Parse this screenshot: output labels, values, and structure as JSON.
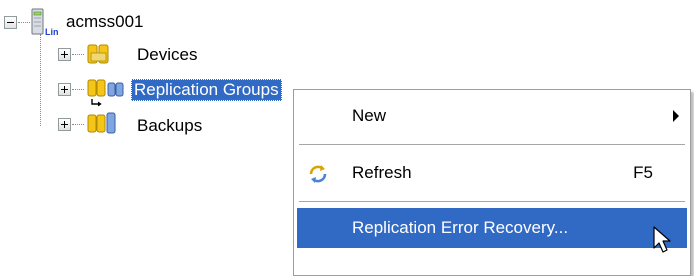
{
  "tree": {
    "root": {
      "label": "acmss001",
      "subscript": "Lin",
      "icon": "linux-server-icon"
    },
    "children": [
      {
        "label": "Devices",
        "icon": "devices-folder-icon",
        "state": "collapsed"
      },
      {
        "label": "Replication Groups",
        "icon": "replication-groups-icon",
        "state": "collapsed",
        "selected": true
      },
      {
        "label": "Backups",
        "icon": "backups-icon",
        "state": "collapsed"
      }
    ]
  },
  "context_menu": {
    "items": [
      {
        "label": "New",
        "has_submenu": true,
        "shortcut": ""
      },
      {
        "label": "Refresh",
        "shortcut": "F5",
        "icon": "refresh-icon"
      },
      {
        "label": "Replication Error Recovery...",
        "shortcut": "",
        "highlighted": true
      }
    ]
  },
  "colors": {
    "selection": "#316ac5",
    "selection_text": "#ffffff",
    "folder_yellow": "#f5c518",
    "lin_subscript": "#1a3fd0"
  }
}
